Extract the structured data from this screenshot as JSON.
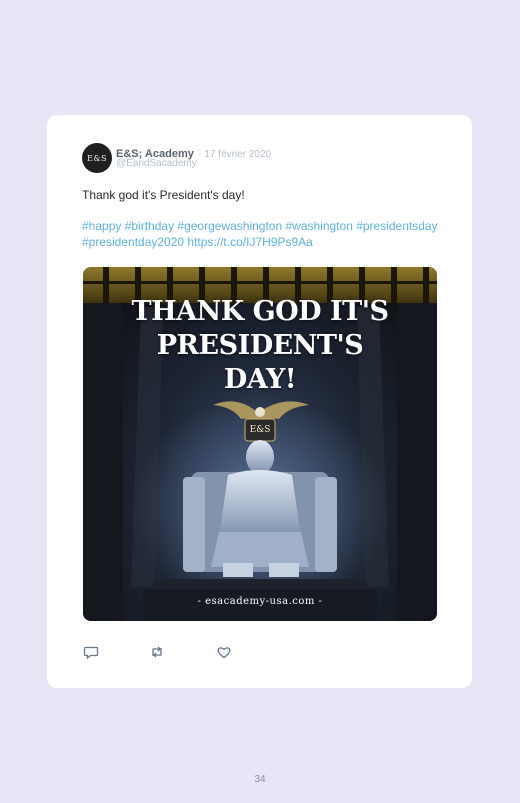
{
  "tweet": {
    "avatar_text": "E&S",
    "author_name": "E&S; Academy",
    "date": "· 17 février 2020",
    "handle": "@EandSacademy",
    "text": "Thank god it's President's day!",
    "hashtags": "#happy #birthday #georgewashington #washington #presidentsday #presidentday2020 https://t.co/IJ7H9Ps9Aa",
    "image": {
      "headline_line1": "THANK GOD IT'S",
      "headline_line2": "PRESIDENT'S",
      "headline_line3": "DAY!",
      "crest_text": "E&S",
      "website": "- esacademy-usa.com -"
    },
    "actions": [
      {
        "name": "reply-icon"
      },
      {
        "name": "retweet-icon"
      },
      {
        "name": "like-icon"
      }
    ]
  },
  "page_number": "34"
}
